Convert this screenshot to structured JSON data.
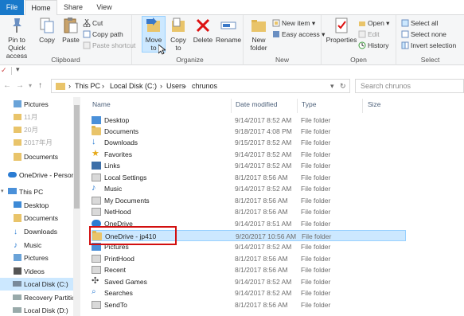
{
  "tabs": {
    "file": "File",
    "home": "Home",
    "share": "Share",
    "view": "View"
  },
  "ribbon": {
    "clipboard": {
      "label": "Clipboard",
      "pin": "Pin to Quick access",
      "copy": "Copy",
      "paste": "Paste",
      "cut": "Cut",
      "copy_path": "Copy path",
      "paste_shortcut": "Paste shortcut"
    },
    "organize": {
      "label": "Organize",
      "move_to": "Move to",
      "copy_to": "Copy to",
      "delete": "Delete",
      "rename": "Rename"
    },
    "new": {
      "label": "New",
      "new_folder": "New folder",
      "new_item": "New item",
      "easy_access": "Easy access"
    },
    "open": {
      "label": "Open",
      "properties": "Properties",
      "open": "Open",
      "edit": "Edit",
      "history": "History"
    },
    "select": {
      "label": "Select",
      "select_all": "Select all",
      "select_none": "Select none",
      "invert": "Invert selection"
    }
  },
  "address": {
    "crumbs": [
      "This PC",
      "Local Disk (C:)",
      "Users",
      "chrunos"
    ],
    "search_placeholder": "Search chrunos"
  },
  "nav": {
    "items": [
      {
        "label": "Pictures",
        "icon": "pictures-icon"
      },
      {
        "label": "11月",
        "icon": "folder-icon"
      },
      {
        "label": "20月",
        "icon": "folder-icon"
      },
      {
        "label": "2017年月",
        "icon": "folder-icon"
      },
      {
        "label": "Documents",
        "icon": "documents-icon"
      },
      {
        "label": "OneDrive - Persor",
        "icon": "onedrive-icon"
      },
      {
        "label": "This PC",
        "icon": "this-pc-icon"
      },
      {
        "label": "Desktop",
        "icon": "desktop-icon"
      },
      {
        "label": "Documents",
        "icon": "documents-icon"
      },
      {
        "label": "Downloads",
        "icon": "downloads-icon"
      },
      {
        "label": "Music",
        "icon": "music-icon"
      },
      {
        "label": "Pictures",
        "icon": "pictures-icon"
      },
      {
        "label": "Videos",
        "icon": "videos-icon"
      },
      {
        "label": "Local Disk (C:)",
        "icon": "local-disk-icon"
      },
      {
        "label": "Recovery Partitic",
        "icon": "drive-icon"
      },
      {
        "label": "Local Disk (D:)",
        "icon": "drive-icon"
      }
    ]
  },
  "list": {
    "headers": {
      "name": "Name",
      "date": "Date modified",
      "type": "Type",
      "size": "Size"
    },
    "rows": [
      {
        "name": "Desktop",
        "date": "9/14/2017 8:52 AM",
        "type": "File folder",
        "icon": "desktop-folder-icon"
      },
      {
        "name": "Documents",
        "date": "9/18/2017 4:08 PM",
        "type": "File folder",
        "icon": "documents-folder-icon"
      },
      {
        "name": "Downloads",
        "date": "9/15/2017 8:52 AM",
        "type": "File folder",
        "icon": "downloads-folder-icon"
      },
      {
        "name": "Favorites",
        "date": "9/14/2017 8:52 AM",
        "type": "File folder",
        "icon": "favorites-folder-icon"
      },
      {
        "name": "Links",
        "date": "9/14/2017 8:52 AM",
        "type": "File folder",
        "icon": "links-folder-icon"
      },
      {
        "name": "Local Settings",
        "date": "8/1/2017 8:56 AM",
        "type": "File folder",
        "icon": "shortcut-folder-icon"
      },
      {
        "name": "Music",
        "date": "9/14/2017 8:52 AM",
        "type": "File folder",
        "icon": "music-folder-icon"
      },
      {
        "name": "My Documents",
        "date": "8/1/2017 8:56 AM",
        "type": "File folder",
        "icon": "shortcut-folder-icon"
      },
      {
        "name": "NetHood",
        "date": "8/1/2017 8:56 AM",
        "type": "File folder",
        "icon": "shortcut-folder-icon"
      },
      {
        "name": "OneDrive",
        "date": "9/14/2017 8:51 AM",
        "type": "File folder",
        "icon": "onedrive-folder-icon"
      },
      {
        "name": "OneDrive - jp410",
        "date": "9/20/2017 10:56 AM",
        "type": "File folder",
        "icon": "folder-icon",
        "selected": true
      },
      {
        "name": "Pictures",
        "date": "9/14/2017 8:52 AM",
        "type": "File folder",
        "icon": "pictures-folder-icon"
      },
      {
        "name": "PrintHood",
        "date": "8/1/2017 8:56 AM",
        "type": "File folder",
        "icon": "shortcut-folder-icon"
      },
      {
        "name": "Recent",
        "date": "8/1/2017 8:56 AM",
        "type": "File folder",
        "icon": "shortcut-folder-icon"
      },
      {
        "name": "Saved Games",
        "date": "9/14/2017 8:52 AM",
        "type": "File folder",
        "icon": "saved-games-folder-icon"
      },
      {
        "name": "Searches",
        "date": "9/14/2017 8:52 AM",
        "type": "File folder",
        "icon": "searches-folder-icon"
      },
      {
        "name": "SendTo",
        "date": "8/1/2017 8:56 AM",
        "type": "File folder",
        "icon": "shortcut-folder-icon"
      }
    ]
  },
  "colors": {
    "accent": "#1979ca",
    "selection": "#cce8ff",
    "highlight_box": "#d20f0f"
  }
}
